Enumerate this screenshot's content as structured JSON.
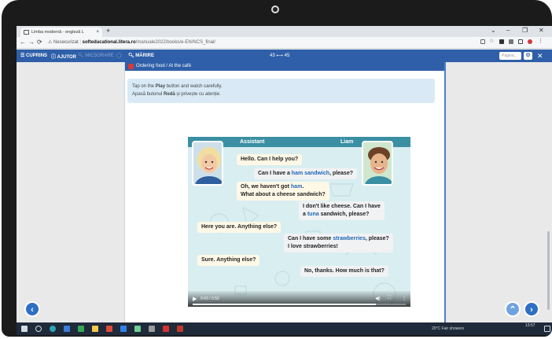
{
  "browser": {
    "tab_title": "Limba modernă - engleză L",
    "tab_close": "×",
    "new_tab": "+",
    "window_controls": [
      "⌄",
      "–",
      "❐",
      "✕"
    ],
    "url_security": "Nesecurizat",
    "url_domain": "softeducational.litera.ro",
    "url_path": "/manuale2022/books/e-EN/NCS_final/"
  },
  "toolbar": {
    "cuprins": "CUPRINS",
    "ajutor": "AJUTOR",
    "micsorare": "MICȘORARE",
    "marire": "MĂRIRE",
    "page_range": "43 ⟷ 45",
    "page_placeholder": "Pagina...",
    "gear": "✿",
    "fullscreen": "⛶"
  },
  "section": {
    "title": "Ordering food / At the café"
  },
  "instructions": {
    "en_before": "Tap on the ",
    "en_bold": "Play",
    "en_after": " button and watch carefully.",
    "ro_before": "Apasă butonul ",
    "ro_bold": "Redă",
    "ro_after": " și privește cu atenție."
  },
  "video": {
    "assistant_label": "Assistant",
    "liam_label": "Liam",
    "lines": {
      "l1": "Hello. Can I help you?",
      "l2a": "Can I have a ",
      "l2b": "ham sandwich",
      "l2c": ", please?",
      "l3a": "Oh, we haven't got ",
      "l3b": "ham",
      "l3c": ".",
      "l3d": "What about a cheese sandwich?",
      "l4a": "I don't like cheese. Can I have",
      "l4b": "a ",
      "l4c": "tuna",
      "l4d": " sandwich, please?",
      "l5": "Here you are. Anything else?",
      "l6a": "Can I have some ",
      "l6b": "strawberries",
      "l6c": ", please?",
      "l6d": "I love strawberries!",
      "l7": "Sure. Anything else?",
      "l8": "No, thanks. How much is that?"
    },
    "time": "0:43 / 0:50",
    "progress": 0.86
  },
  "nav": {
    "prev": "‹",
    "up": "⌃",
    "next": "›"
  },
  "taskbar": {
    "weather": "20°C Fair showers",
    "clock": "13:57"
  },
  "colors": {
    "toolbar_blue": "#2f5fa8",
    "highlight_blue": "#1f67b4",
    "video_header": "#3a8fa3",
    "nav_blue": "#2e6fc4",
    "nav_light": "#6fa3e0"
  }
}
